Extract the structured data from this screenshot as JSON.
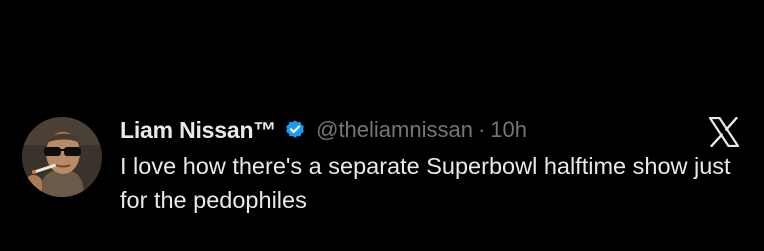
{
  "tweet": {
    "author": {
      "display_name": "Liam Nissan™",
      "handle": "@theliamnissan",
      "verified": true,
      "avatar_icon": "profile-photo-man-with-sunglasses-smoking"
    },
    "separator": "·",
    "time": "10h",
    "text": "I love how there's a separate Superbowl halftime show just for the pedophiles",
    "platform_icon": "x-logo-icon"
  },
  "colors": {
    "background": "#000000",
    "primary_text": "#e7e9ea",
    "secondary_text": "#71767b",
    "verified_badge": "#1d9bf0"
  }
}
